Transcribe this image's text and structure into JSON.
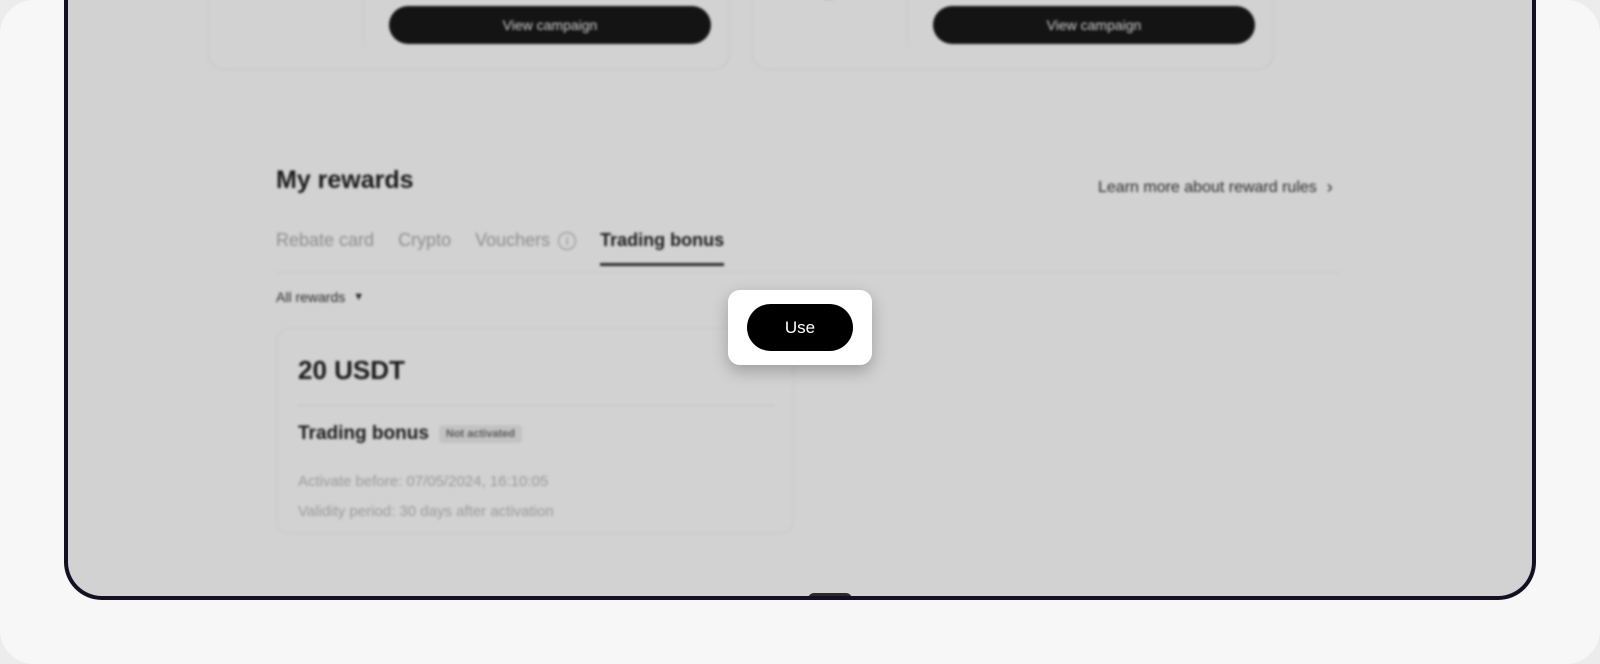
{
  "campaigns": [
    {
      "button_label": "View campaign"
    },
    {
      "button_label": "View campaign"
    }
  ],
  "rewards": {
    "title": "My rewards",
    "learn_more": "Learn more about reward rules",
    "tabs": [
      {
        "label": "Rebate card",
        "active": false
      },
      {
        "label": "Crypto",
        "active": false
      },
      {
        "label": "Vouchers",
        "active": false,
        "has_info_icon": true
      },
      {
        "label": "Trading bonus",
        "active": true
      }
    ],
    "filter_label": "All rewards",
    "card": {
      "amount": "20 USDT",
      "name": "Trading bonus",
      "status_badge": "Not activated",
      "activate_before": "Activate before: 07/05/2024, 16:10:05",
      "validity": "Validity period: 30 days after activation",
      "use_label": "Use"
    }
  }
}
